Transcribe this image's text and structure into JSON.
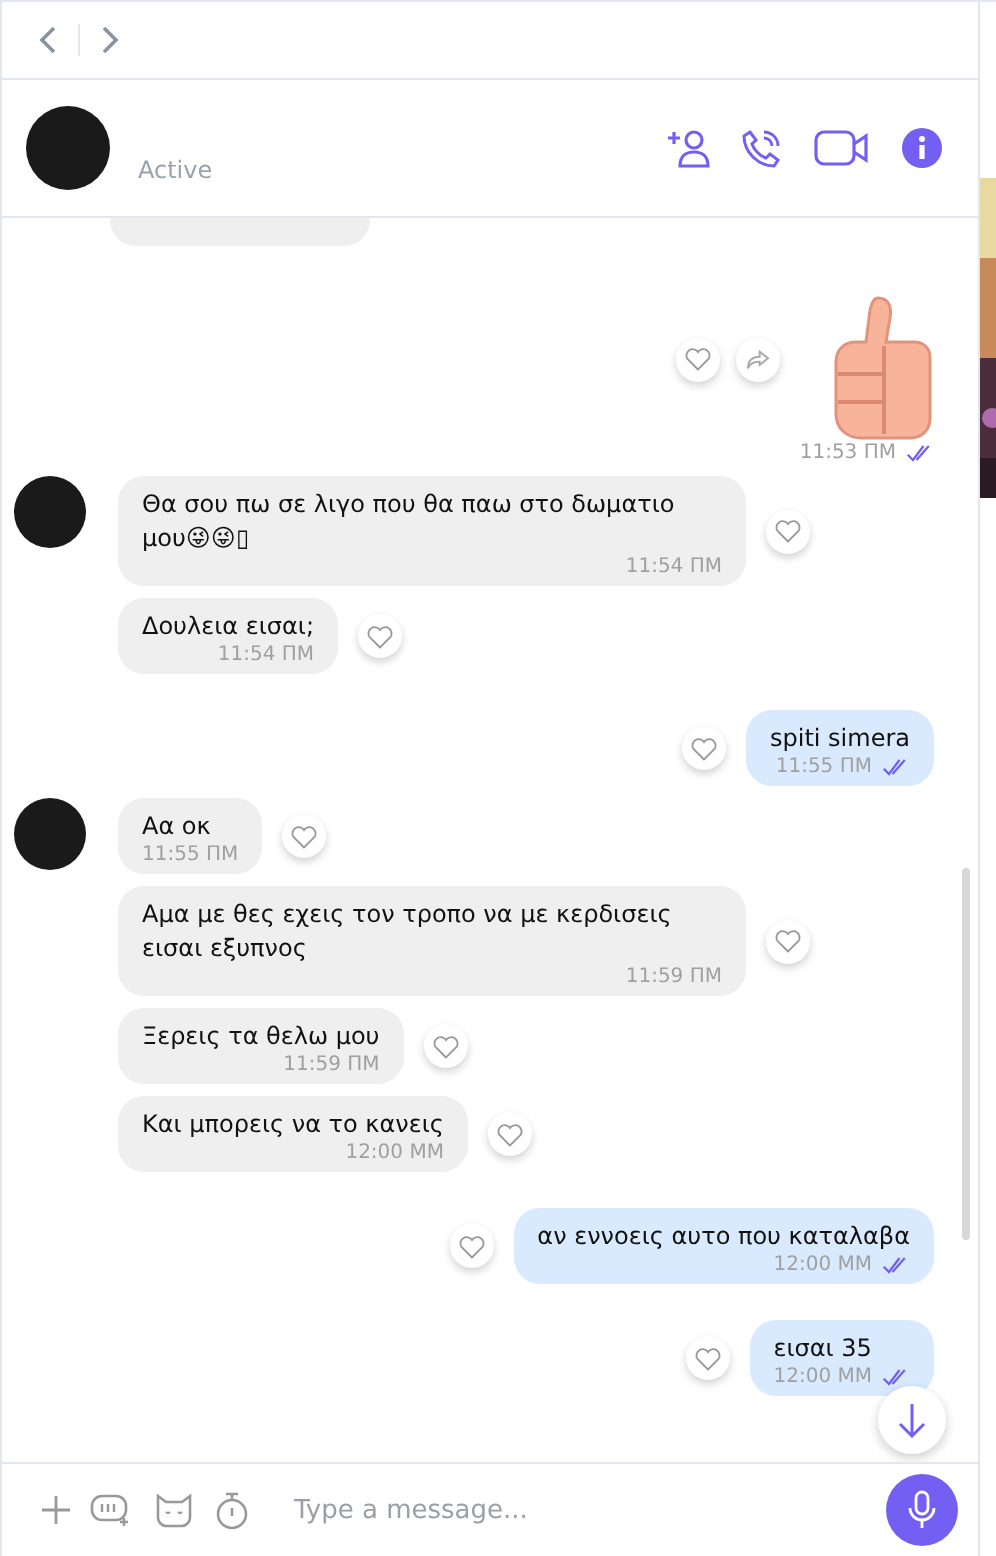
{
  "header": {
    "status": "Active"
  },
  "messages": [
    {
      "kind": "cut",
      "outgoing": false
    },
    {
      "kind": "sticker",
      "outgoing": true,
      "time": "11:53 ΠΜ",
      "read": true
    },
    {
      "kind": "text",
      "outgoing": false,
      "text": "Θα σου πω σε λιγο που θα παω στο δωματιο μου😜😜▯",
      "time": "11:54 ΠΜ",
      "read": false,
      "avatar": true
    },
    {
      "kind": "text",
      "outgoing": false,
      "text": "Δουλεια εισαι;",
      "time": "11:54 ΠΜ",
      "read": false,
      "avatar": false
    },
    {
      "kind": "text",
      "outgoing": true,
      "text": "spiti simera",
      "time": "11:55 ΠΜ",
      "read": true,
      "avatar": false
    },
    {
      "kind": "text",
      "outgoing": false,
      "text": "Αα οκ",
      "time": "11:55 ΠΜ",
      "read": false,
      "avatar": true
    },
    {
      "kind": "text",
      "outgoing": false,
      "text": "Αμα  με θες εχεις τον τροπο να με κερδισεις εισαι εξυπνος",
      "time": "11:59 ΠΜ",
      "read": false,
      "avatar": false
    },
    {
      "kind": "text",
      "outgoing": false,
      "text": "Ξερεις τα θελω μου",
      "time": "11:59 ΠΜ",
      "read": false,
      "avatar": false
    },
    {
      "kind": "text",
      "outgoing": false,
      "text": "Και μπορεις να το κανεις",
      "time": "12:00 ΜΜ",
      "read": false,
      "avatar": false
    },
    {
      "kind": "text",
      "outgoing": true,
      "text": "αν εννοεις αυτο που καταλαβα",
      "time": "12:00 ΜΜ",
      "read": true,
      "avatar": false
    },
    {
      "kind": "text",
      "outgoing": true,
      "text": "εισαι 35",
      "time": "12:00 ΜΜ",
      "read": true,
      "avatar": false
    }
  ],
  "composer": {
    "placeholder": "Type a message..."
  }
}
